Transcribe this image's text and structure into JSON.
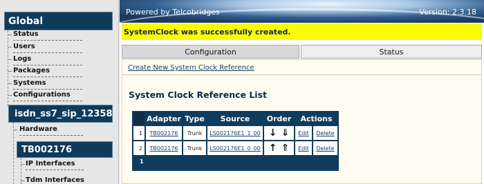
{
  "sidebar": {
    "global_title": "Global",
    "global_items": [
      "Status",
      "Users",
      "Logs",
      "Packages",
      "Systems",
      "Configurations"
    ],
    "config_title": "isdn_ss7_sip_12358",
    "config_items": [
      "Hardware"
    ],
    "adapter_title": "TB002176",
    "adapter_items": [
      "IP Interfaces",
      "Tdm Interfaces"
    ]
  },
  "banner": {
    "powered_by": "Powered by Telcobridges",
    "version": "Version: 2.3.18"
  },
  "alert": "SystemClock was successfully created.",
  "tabs": [
    {
      "label": "Configuration",
      "active": true
    },
    {
      "label": "Status",
      "active": false
    }
  ],
  "create_link": "Create New System Clock Reference",
  "list_title": "System Clock Reference List",
  "table": {
    "headers": [
      "Adapter",
      "Type",
      "Source",
      "Order",
      "Actions"
    ],
    "rows": [
      {
        "index": "1",
        "adapter": "TB002176",
        "type": "Trunk",
        "source": "LS002176E1_1_00",
        "order_up": false,
        "edit": "Edit",
        "delete": "Delete"
      },
      {
        "index": "2",
        "adapter": "TB002176",
        "type": "Trunk",
        "source": "LS002176E1_0_00",
        "order_up": true,
        "edit": "Edit",
        "delete": "Delete"
      }
    ],
    "footer_page": "1"
  }
}
